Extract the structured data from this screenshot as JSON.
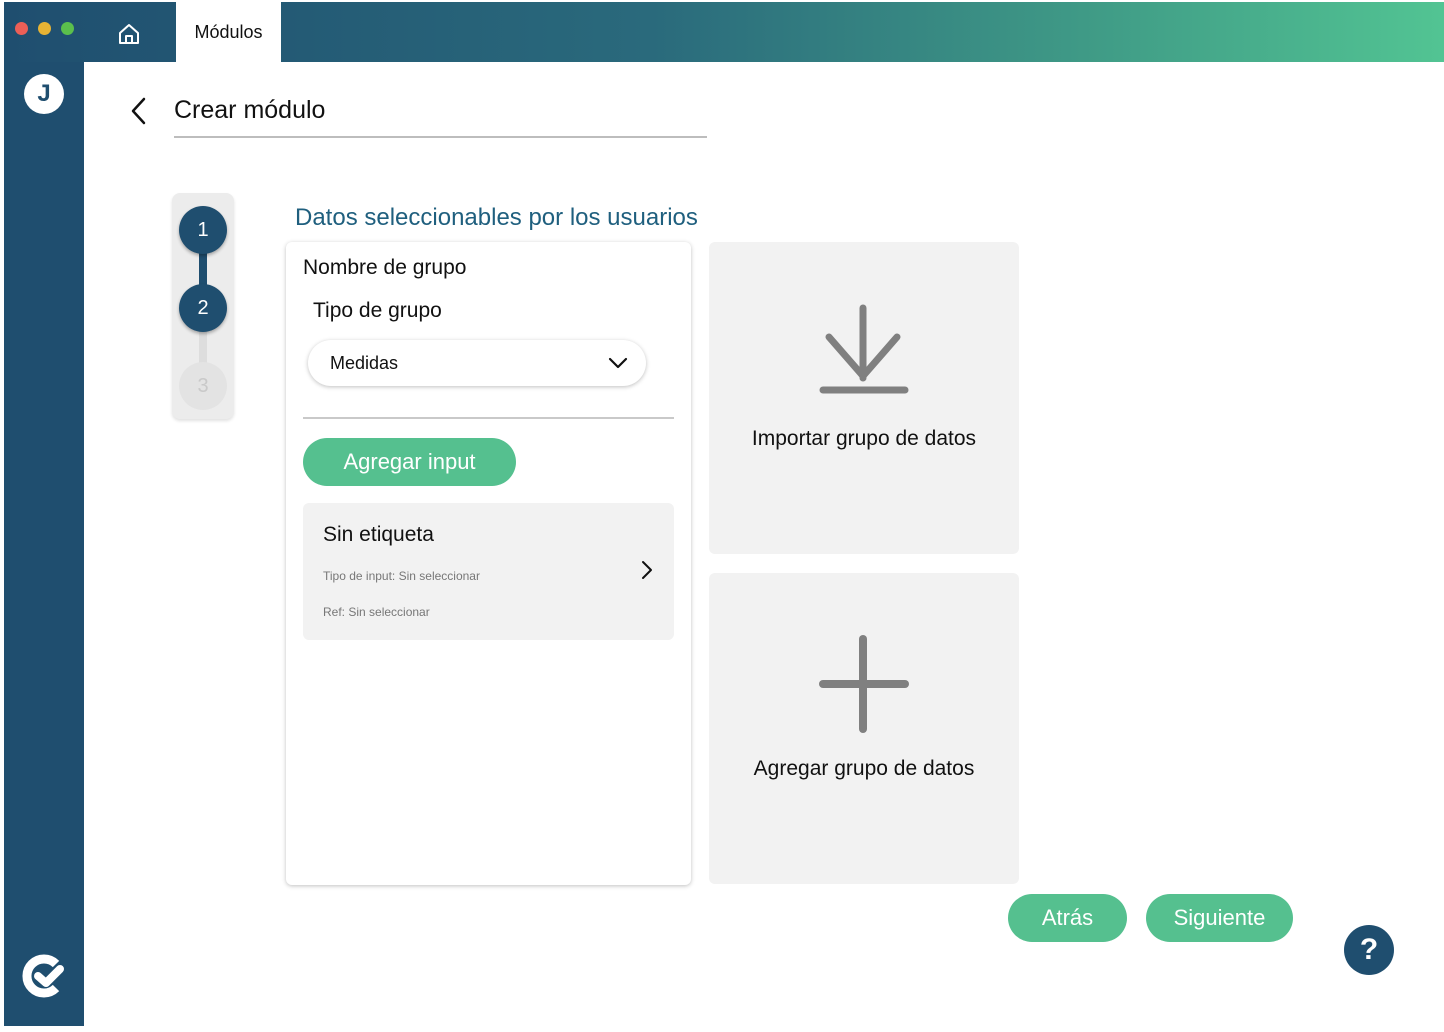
{
  "window": {
    "controls": [
      "close",
      "minimize",
      "maximize"
    ],
    "home_icon": "home-icon",
    "active_tab": "Módulos"
  },
  "sidebar": {
    "avatar_initial": "J",
    "logo_icon": "brand-logo-icon"
  },
  "header": {
    "back_icon": "chevron-left-icon",
    "title": "Crear módulo"
  },
  "stepper": {
    "steps": [
      "1",
      "2",
      "3"
    ],
    "current_step": 2
  },
  "section": {
    "title": "Datos seleccionables por los usuarios"
  },
  "group_card": {
    "group_name": "Nombre de grupo",
    "group_type_label": "Tipo de grupo",
    "group_type_value": "Medidas",
    "add_input_label": "Agregar input",
    "inputs": [
      {
        "label": "Sin etiqueta",
        "type_text": "Tipo de input: Sin seleccionar",
        "ref_text": "Ref: Sin seleccionar"
      }
    ]
  },
  "tiles": {
    "import_label": "Importar grupo de datos",
    "import_icon": "download-icon",
    "add_label": "Agregar grupo de datos",
    "add_icon": "plus-icon"
  },
  "footer": {
    "back_label": "Atrás",
    "next_label": "Siguiente",
    "help_label": "?"
  },
  "colors": {
    "primary": "#1f4e6f",
    "accent_green": "#55c08f",
    "section_title": "#1f5f7e",
    "tile_bg": "#f2f2f2"
  }
}
